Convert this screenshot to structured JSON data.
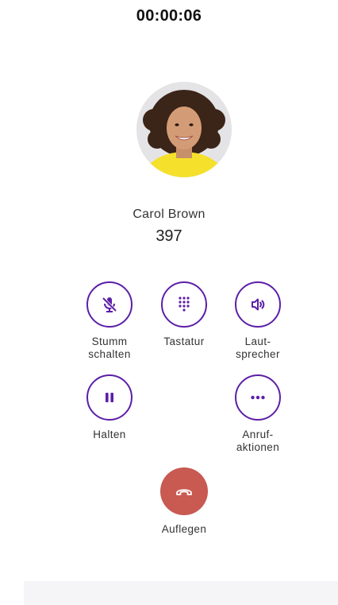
{
  "call": {
    "duration": "00:00:06",
    "caller_name": "Carol Brown",
    "caller_number": "397"
  },
  "actions": {
    "mute_label": "Stumm\nschalten",
    "keypad_label": "Tastatur",
    "speaker_label": "Laut-\nsprecher",
    "hold_label": "Halten",
    "call_actions_label": "Anruf-\naktionen",
    "hangup_label": "Auflegen"
  },
  "icons": {
    "mute": "mic-off-icon",
    "keypad": "dialpad-icon",
    "speaker": "speaker-icon",
    "hold": "pause-icon",
    "more": "more-horizontal-icon",
    "hangup": "call-end-icon"
  },
  "colors": {
    "accent": "#5c1fa8",
    "hangup": "#c85a52",
    "background": "#ffffff",
    "bottom_bar": "#f5f4f7"
  }
}
